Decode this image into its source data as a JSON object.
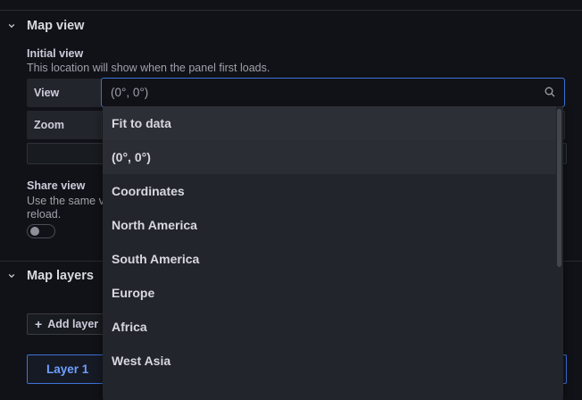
{
  "map_view": {
    "title": "Map view",
    "initial_view_label": "Initial view",
    "initial_view_desc": "This location will show when the panel first loads.",
    "view_label": "View",
    "view_value": "(0°, 0°)",
    "zoom_label": "Zoom",
    "share_view_label": "Share view",
    "share_view_desc_line1": "Use the same v",
    "share_view_desc_line2": "reload."
  },
  "map_layers": {
    "title": "Map layers",
    "add_layer_label": "Add layer",
    "layer_name": "Layer 1"
  },
  "dropdown": {
    "options": [
      {
        "label": "Fit to data"
      },
      {
        "label": "(0°, 0°)"
      },
      {
        "label": "Coordinates"
      },
      {
        "label": "North America"
      },
      {
        "label": "South America"
      },
      {
        "label": "Europe"
      },
      {
        "label": "Africa"
      },
      {
        "label": "West Asia"
      }
    ],
    "hover_index": 0,
    "selected_index": 1
  },
  "colors": {
    "accent": "#3d71d9",
    "link": "#6e9fff",
    "background": "#111217",
    "menu_background": "#22252b"
  }
}
